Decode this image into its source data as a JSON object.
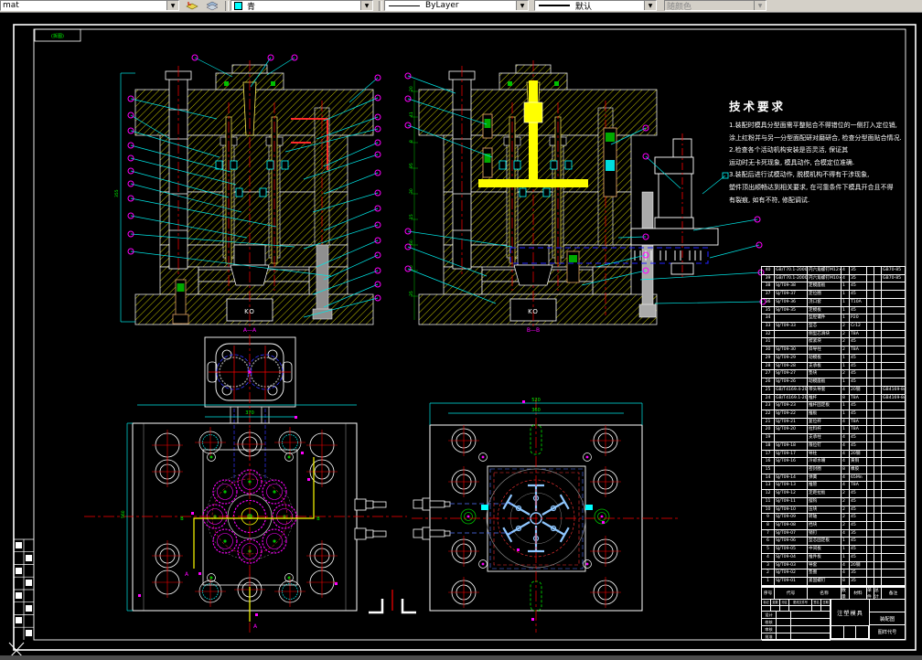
{
  "toolbar": {
    "text_style_value": "mat",
    "layer_value": "青",
    "linetype_value": "ByLayer",
    "lineweight_value": "默认",
    "plotstyle_value": "随颜色"
  },
  "sheet": {
    "corner_label": "(拆图)"
  },
  "tech_requirements": {
    "title": "技术要求",
    "lines": [
      "1.装配时模具分型面需平整贴合不得错位的一侧打入定位销,",
      "涂上红粉并与另一分型面配研对磨研合, 检查分型面贴合情况.",
      "2.检查各个活动机构安装是否灵活, 保证其",
      "运动时无卡死现象, 模具动作, 合模定位准确.",
      "3.装配后进行试模动作, 脱模机构不得有干涉现象,",
      "塑件顶出顺畅达到相关要求, 在可靠条件下模具开合且不得",
      "有裂痕, 如有不符, 修配调试."
    ]
  },
  "views": {
    "section_a": {
      "label": "A—A",
      "ko": "KO",
      "height_dim": "355"
    },
    "section_b": {
      "label": "B—B",
      "ko": "KO",
      "dim_values": [
        "20",
        "41",
        "8",
        "95",
        "30",
        "15",
        "60",
        "10",
        "35"
      ]
    },
    "plan_left": {
      "width_dim": "370",
      "height_dim": "560",
      "mark": "B",
      "arrow_label": "A"
    },
    "plan_right": {
      "outer_dim": "520",
      "inner_dim": "360"
    }
  },
  "bom": {
    "headers": [
      "序号",
      "代号",
      "名称",
      "数量",
      "材料",
      "单件",
      "总计",
      "备注"
    ],
    "rows": [
      [
        "40",
        "GB/T70.1-2000",
        "内六角螺钉M12×40",
        "4",
        "35",
        "",
        "",
        "GB70-85"
      ],
      [
        "39",
        "GB/T70.1-2000",
        "内六角螺钉M10×30",
        "4",
        "35",
        "",
        "",
        "GB70-85"
      ],
      [
        "38",
        "SJ/T09-38",
        "定模座板",
        "1",
        "45",
        "",
        "",
        ""
      ],
      [
        "37",
        "SJ/T09-37",
        "定位圈",
        "1",
        "45",
        "",
        "",
        ""
      ],
      [
        "36",
        "SJ/T09-36",
        "浇口套",
        "1",
        "T10A",
        "",
        "",
        ""
      ],
      [
        "35",
        "SJ/T09-35",
        "定模板",
        "1",
        "45",
        "",
        "",
        ""
      ],
      [
        "34",
        "",
        "型腔镶件",
        "1",
        "P20",
        "",
        "",
        ""
      ],
      [
        "33",
        "SJ/T09-33",
        "型芯",
        "2",
        "Cr12",
        "",
        "",
        ""
      ],
      [
        "32",
        "",
        "侧型芯滑块",
        "2",
        "T8A",
        "",
        "",
        ""
      ],
      [
        "31",
        "",
        "楔紧块",
        "2",
        "45",
        "",
        "",
        ""
      ],
      [
        "30",
        "SJ/T09-30",
        "斜导柱",
        "2",
        "T8A",
        "",
        "",
        ""
      ],
      [
        "29",
        "SJ/T09-29",
        "动模板",
        "1",
        "45",
        "",
        "",
        ""
      ],
      [
        "28",
        "SJ/T09-28",
        "支承板",
        "1",
        "45",
        "",
        "",
        ""
      ],
      [
        "27",
        "SJ/T09-27",
        "垫块",
        "2",
        "45",
        "",
        "",
        ""
      ],
      [
        "26",
        "SJ/T09-26",
        "动模座板",
        "1",
        "45",
        "",
        "",
        ""
      ],
      [
        "25",
        "GB/T4169.4-2006",
        "带头导套",
        "4",
        "20钢",
        "",
        "",
        "GB4169-84"
      ],
      [
        "24",
        "GB/T4169.1-2006",
        "推杆",
        "8",
        "T8A",
        "",
        "",
        "GB4169-84"
      ],
      [
        "23",
        "SJ/T09-23",
        "推杆固定板",
        "1",
        "45",
        "",
        "",
        ""
      ],
      [
        "22",
        "SJ/T09-22",
        "推板",
        "1",
        "45",
        "",
        "",
        ""
      ],
      [
        "21",
        "SJ/T09-21",
        "复位杆",
        "4",
        "T8A",
        "",
        "",
        ""
      ],
      [
        "20",
        "SJ/T09-20",
        "拉料杆",
        "1",
        "T8A",
        "",
        "",
        ""
      ],
      [
        "19",
        "",
        "支承柱",
        "4",
        "45",
        "",
        "",
        ""
      ],
      [
        "18",
        "SJ/T09-18",
        "限位钉",
        "4",
        "45",
        "",
        "",
        ""
      ],
      [
        "17",
        "SJ/T09-17",
        "导柱",
        "4",
        "20钢",
        "",
        "",
        ""
      ],
      [
        "16",
        "SJ/T09-16",
        "冷却水嘴",
        "4",
        "黄铜",
        "",
        "",
        ""
      ],
      [
        "15",
        "",
        "密封圈",
        "8",
        "橡胶",
        "",
        "",
        ""
      ],
      [
        "14",
        "SJ/T09-14",
        "弹簧",
        "4",
        "65Mn",
        "",
        "",
        ""
      ],
      [
        "13",
        "SJ/T09-13",
        "推管",
        "4",
        "T8A",
        "",
        "",
        ""
      ],
      [
        "12",
        "SJ/T09-12",
        "定距拉板",
        "2",
        "45",
        "",
        "",
        ""
      ],
      [
        "11",
        "SJ/T09-11",
        "摆钩",
        "2",
        "45",
        "",
        "",
        ""
      ],
      [
        "10",
        "SJ/T09-10",
        "压块",
        "2",
        "45",
        "",
        "",
        ""
      ],
      [
        "9",
        "SJ/T09-09",
        "转轴",
        "2",
        "45",
        "",
        "",
        ""
      ],
      [
        "8",
        "SJ/T09-08",
        "挡块",
        "2",
        "45",
        "",
        "",
        ""
      ],
      [
        "7",
        "SJ/T09-07",
        "销钉",
        "4",
        "35",
        "",
        "",
        ""
      ],
      [
        "6",
        "SJ/T09-06",
        "型芯固定板",
        "1",
        "45",
        "",
        "",
        ""
      ],
      [
        "5",
        "SJ/T09-05",
        "中间板",
        "1",
        "45",
        "",
        "",
        ""
      ],
      [
        "4",
        "SJ/T09-04",
        "推件板",
        "1",
        "45",
        "",
        "",
        ""
      ],
      [
        "3",
        "SJ/T09-03",
        "导套",
        "4",
        "20钢",
        "",
        "",
        ""
      ],
      [
        "2",
        "SJ/T09-02",
        "垫圈",
        "4",
        "35",
        "",
        "",
        ""
      ],
      [
        "1",
        "SJ/T09-01",
        "紧固螺钉",
        "8",
        "35",
        "",
        "",
        ""
      ]
    ]
  },
  "title_block": {
    "title": "注塑模具",
    "sheet_type": "装配图",
    "code_label": "图样代号",
    "signature_labels": [
      "标记",
      "处数",
      "分区",
      "更改文件号",
      "签名",
      "日期"
    ],
    "approval_labels": [
      "设计",
      "校核",
      "审核",
      "批准"
    ]
  },
  "colors": {
    "hatch": "#e6e600",
    "leader": "#00e5e5",
    "balloon": "#ff00ff",
    "centerline": "#ff0000",
    "dim_text": "#00ff00",
    "outline": "#ffffff",
    "toolbar_bg": "#d4d0c8",
    "layer_swatch": "#00ffff"
  }
}
